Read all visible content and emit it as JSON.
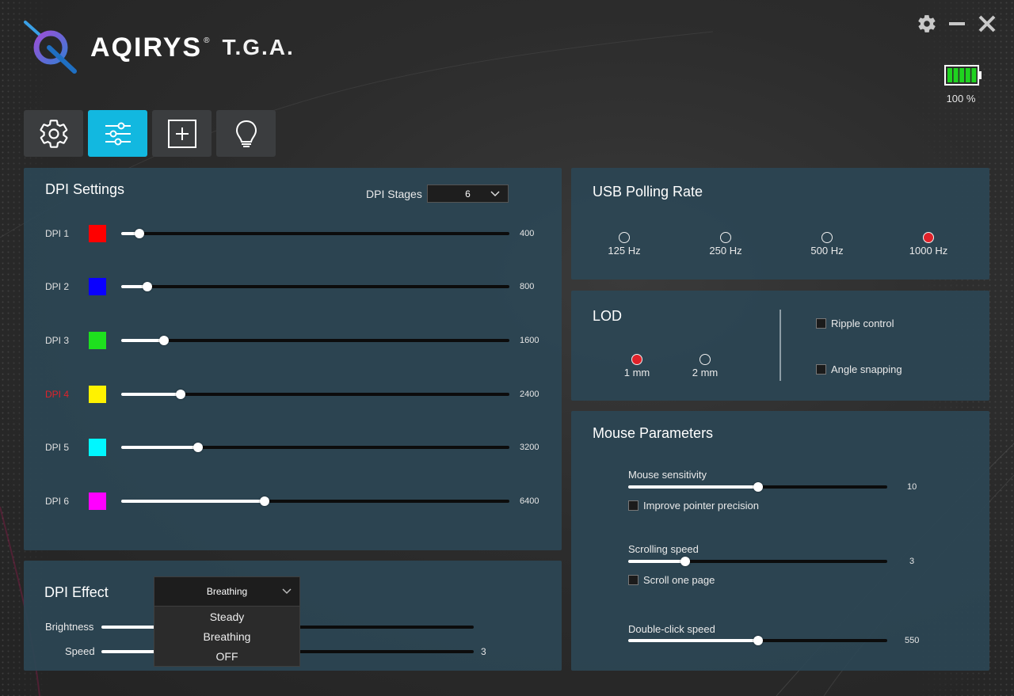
{
  "app": {
    "brand": "AQIRYS",
    "brand_mark": "®",
    "product": "T.G.A."
  },
  "window_controls": {
    "settings": "gear-icon",
    "minimize": "minimize-icon",
    "close": "close-icon"
  },
  "battery": {
    "level_percent": 100,
    "label": "100 %",
    "color": "#1fd31f"
  },
  "tabs": [
    {
      "icon": "gear-icon",
      "active": false
    },
    {
      "icon": "sliders-icon",
      "active": true
    },
    {
      "icon": "plus-square-icon",
      "active": false
    },
    {
      "icon": "bulb-icon",
      "active": false
    }
  ],
  "accent_color": "#12b8e0",
  "dpi_settings": {
    "title": "DPI Settings",
    "stages_label": "DPI Stages",
    "stages_value": "6",
    "max_dpi": 16000,
    "rows": [
      {
        "label": "DPI 1",
        "color": "#ff0000",
        "value": "400",
        "active": false
      },
      {
        "label": "DPI 2",
        "color": "#0a00ff",
        "value": "800",
        "active": false
      },
      {
        "label": "DPI 3",
        "color": "#1ee01e",
        "value": "1600",
        "active": false
      },
      {
        "label": "DPI 4",
        "color": "#fff200",
        "value": "2400",
        "active": true
      },
      {
        "label": "DPI 5",
        "color": "#00f7ff",
        "value": "3200",
        "active": false
      },
      {
        "label": "DPI 6",
        "color": "#ff00ff",
        "value": "6400",
        "active": false
      }
    ]
  },
  "dpi_effect": {
    "title": "DPI Effect",
    "selected": "Breathing",
    "options": [
      "Steady",
      "Breathing",
      "OFF"
    ],
    "brightness_label": "Brightness",
    "speed_label": "Speed",
    "speed_value": "3"
  },
  "usb_polling": {
    "title": "USB Polling Rate",
    "options": [
      {
        "label": "125 Hz",
        "checked": false
      },
      {
        "label": "250 Hz",
        "checked": false
      },
      {
        "label": "500 Hz",
        "checked": false
      },
      {
        "label": "1000 Hz",
        "checked": true
      }
    ]
  },
  "lod": {
    "title": "LOD",
    "options": [
      {
        "label": "1 mm",
        "checked": true
      },
      {
        "label": "2 mm",
        "checked": false
      }
    ],
    "ripple_control": "Ripple control",
    "angle_snapping": "Angle snapping"
  },
  "mouse_parameters": {
    "title": "Mouse Parameters",
    "sensitivity_label": "Mouse sensitivity",
    "sensitivity_value": "10",
    "sensitivity_fraction": 0.5,
    "improve_precision": "Improve pointer precision",
    "scroll_label": "Scrolling speed",
    "scroll_value": "3",
    "scroll_fraction": 0.22,
    "scroll_one_page": "Scroll one page",
    "doubleclick_label": "Double-click speed",
    "doubleclick_value": "550",
    "doubleclick_fraction": 0.5
  }
}
